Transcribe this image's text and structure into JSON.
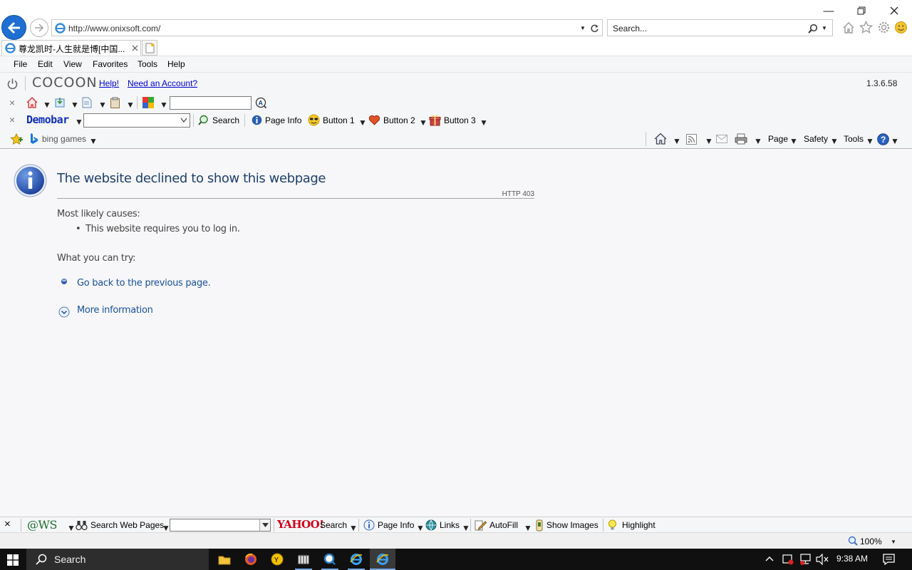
{
  "address": {
    "url": "http://www.onixsoft.com/"
  },
  "search": {
    "placeholder": "Search..."
  },
  "tab": {
    "title": "尊龙凯时-人生就是博[中国..."
  },
  "menu": [
    "File",
    "Edit",
    "View",
    "Favorites",
    "Tools",
    "Help"
  ],
  "cocoon": {
    "logo": "COCOON",
    "help": "Help!",
    "account": "Need an Account?",
    "version": "1.3.6.58"
  },
  "demobar": {
    "logo": "Demobar",
    "search": "Search",
    "page_info": "Page Info",
    "button1": "Button 1",
    "button2": "Button 2",
    "button3": "Button 3"
  },
  "favorites": {
    "item": "bing games"
  },
  "command": {
    "page": "Page",
    "safety": "Safety",
    "tools": "Tools"
  },
  "error": {
    "title": "The website declined to show this webpage",
    "code": "HTTP 403",
    "causes_heading": "Most likely causes:",
    "cause1": "This website requires you to log in.",
    "try_heading": "What you can try:",
    "go_back": "Go back to the previous page.",
    "more_info": "More information"
  },
  "bottombar": {
    "ws_logo": "@WS",
    "search_web_pages": "Search Web Pages",
    "yahoo": "YAHOO!",
    "search": "Search",
    "page_info": "Page Info",
    "links": "Links",
    "autofill": "AutoFill",
    "show_images": "Show Images",
    "highlight": "Highlight"
  },
  "status": {
    "zoom": "100%"
  },
  "taskbar": {
    "search": "Search",
    "time": "9:38 AM"
  },
  "colors": {
    "accent": "#1e6fd1",
    "error_title": "#1e3f6e",
    "link": "#17519a",
    "taskbar": "#101010"
  }
}
